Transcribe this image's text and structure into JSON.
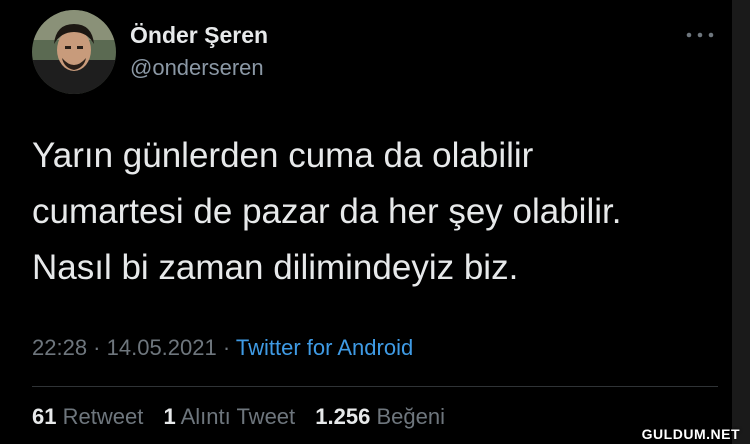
{
  "user": {
    "name": "Önder Şeren",
    "handle": "@onderseren"
  },
  "tweet": {
    "line1": "Yarın günlerden cuma da olabilir",
    "line2": "cumartesi de pazar da her şey olabilir.",
    "line3": "Nasıl bi zaman dilimindeyiz biz."
  },
  "meta": {
    "time": "22:28",
    "sep1": " · ",
    "date": "14.05.2021",
    "sep2": " · ",
    "source": "Twitter for Android"
  },
  "stats": {
    "retweet_count": "61",
    "retweet_label": "Retweet",
    "quote_count": "1",
    "quote_label": "Alıntı Tweet",
    "like_count": "1.256",
    "like_label": "Beğeni"
  },
  "watermark": "GULDUM.NET",
  "icons": {
    "more": "more-icon",
    "avatar": "avatar"
  }
}
